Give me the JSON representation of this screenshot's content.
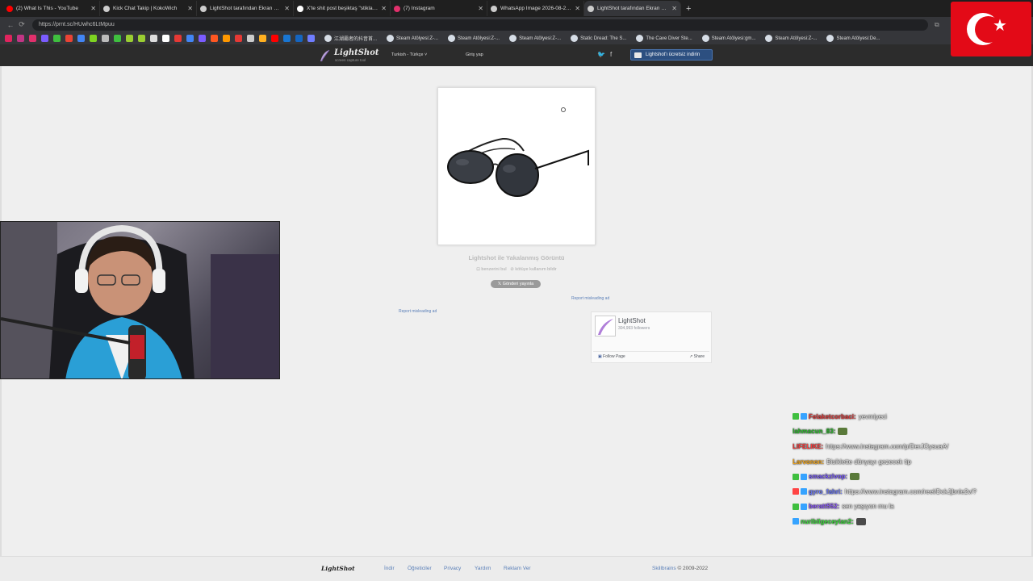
{
  "browser": {
    "tabs": [
      {
        "title": "(2) What Is This - YouTube",
        "color": "#ff0000"
      },
      {
        "title": "Kick Chat Takip | KokoWich",
        "color": "#cccccc"
      },
      {
        "title": "LightShot tarafından Ekran Görünt",
        "color": "#cccccc"
      },
      {
        "title": "X'te shit post beşiktaş \"stiklayın a",
        "color": "#ffffff"
      },
      {
        "title": "(7) Instagram",
        "color": "#e1306c"
      },
      {
        "title": "WhatsApp Image 2026-08-28 at 0",
        "color": "#cccccc"
      },
      {
        "title": "LightShot tarafından Ekran Görünt",
        "color": "#cccccc"
      }
    ],
    "active_tab": 6,
    "url": "https://prnt.sc/HUwhc6LtMpuu",
    "bookmarks": [
      "江湖霸者的抖音首...",
      "Steam Atölyesi:Z-...",
      "Steam Atölyesi:Z-...",
      "Steam Atölyesi:Z-...",
      "Static Dread: The S...",
      "The Cave Diver Ste...",
      "Steam Atölyesi:gm...",
      "Steam Atölyesi:Z-...",
      "Steam Atölyesi:De..."
    ]
  },
  "lightshot": {
    "logo": "LightShot",
    "logo_tagline": "screen capture tool",
    "language": "Turkish - Türkçe",
    "login": "Giriş yap",
    "download_label": "Lightshot'ı ücretsiz indirin",
    "caption": "Lightshot ile Yakalanmış Görüntü",
    "similar": "benzerini bul",
    "usage": "kötüye kullanım bildir",
    "tweet_label": "Gönderi yayınla",
    "report_ad": "Report misleading ad",
    "fb": {
      "name": "LightShot",
      "followers": "304,993 followers",
      "follow": "Follow Page",
      "share": "Share"
    }
  },
  "chat": [
    {
      "user": "Felaketcorbaci:",
      "user_color": "#e23b3b",
      "msg": "yevmiyeci",
      "badges": [
        "#3fbf3f",
        "#36a3ff"
      ]
    },
    {
      "user": "lahmacun_83:",
      "user_color": "#2fbf2f",
      "msg": "",
      "emote": "#5a7a3a",
      "badges": []
    },
    {
      "user": "LIFELIKE:",
      "user_color": "#ff3b3b",
      "msg": "https://www.instagram.com/p/DerJOysuaA/",
      "badges": []
    },
    {
      "user": "Larvonon:",
      "user_color": "#ffb020",
      "msg": "Bisiklette dünyayı gezecek tip",
      "badges": []
    },
    {
      "user": "smackzlvop:",
      "user_color": "#7b5cff",
      "msg": "",
      "emote": "#5a7a3a",
      "badges": [
        "#3fbf3f",
        "#36a3ff"
      ]
    },
    {
      "user": "gyro_fahri:",
      "user_color": "#6f7dff",
      "msg": "https://www.instagram.com/reel/DckJjbnle2v/?",
      "badges": [
        "#ff4444",
        "#36a3ff"
      ]
    },
    {
      "user": "beratt552:",
      "user_color": "#8f5bff",
      "msg": "sen yaşıyon mu la",
      "badges": [
        "#3fbf3f",
        "#36a3ff"
      ]
    },
    {
      "user": "nuribilgeceylan2:",
      "user_color": "#3fdf3f",
      "msg": "",
      "emote": "#4a4a4a",
      "badges": [
        "#36a3ff"
      ]
    }
  ],
  "footer": {
    "logo": "LightShot",
    "links": [
      "İndir",
      "Öğreticiler",
      "Privacy",
      "Yardım",
      "Reklam Ver"
    ],
    "company": "Skillbrains",
    "copyright": "© 2009-2022"
  }
}
